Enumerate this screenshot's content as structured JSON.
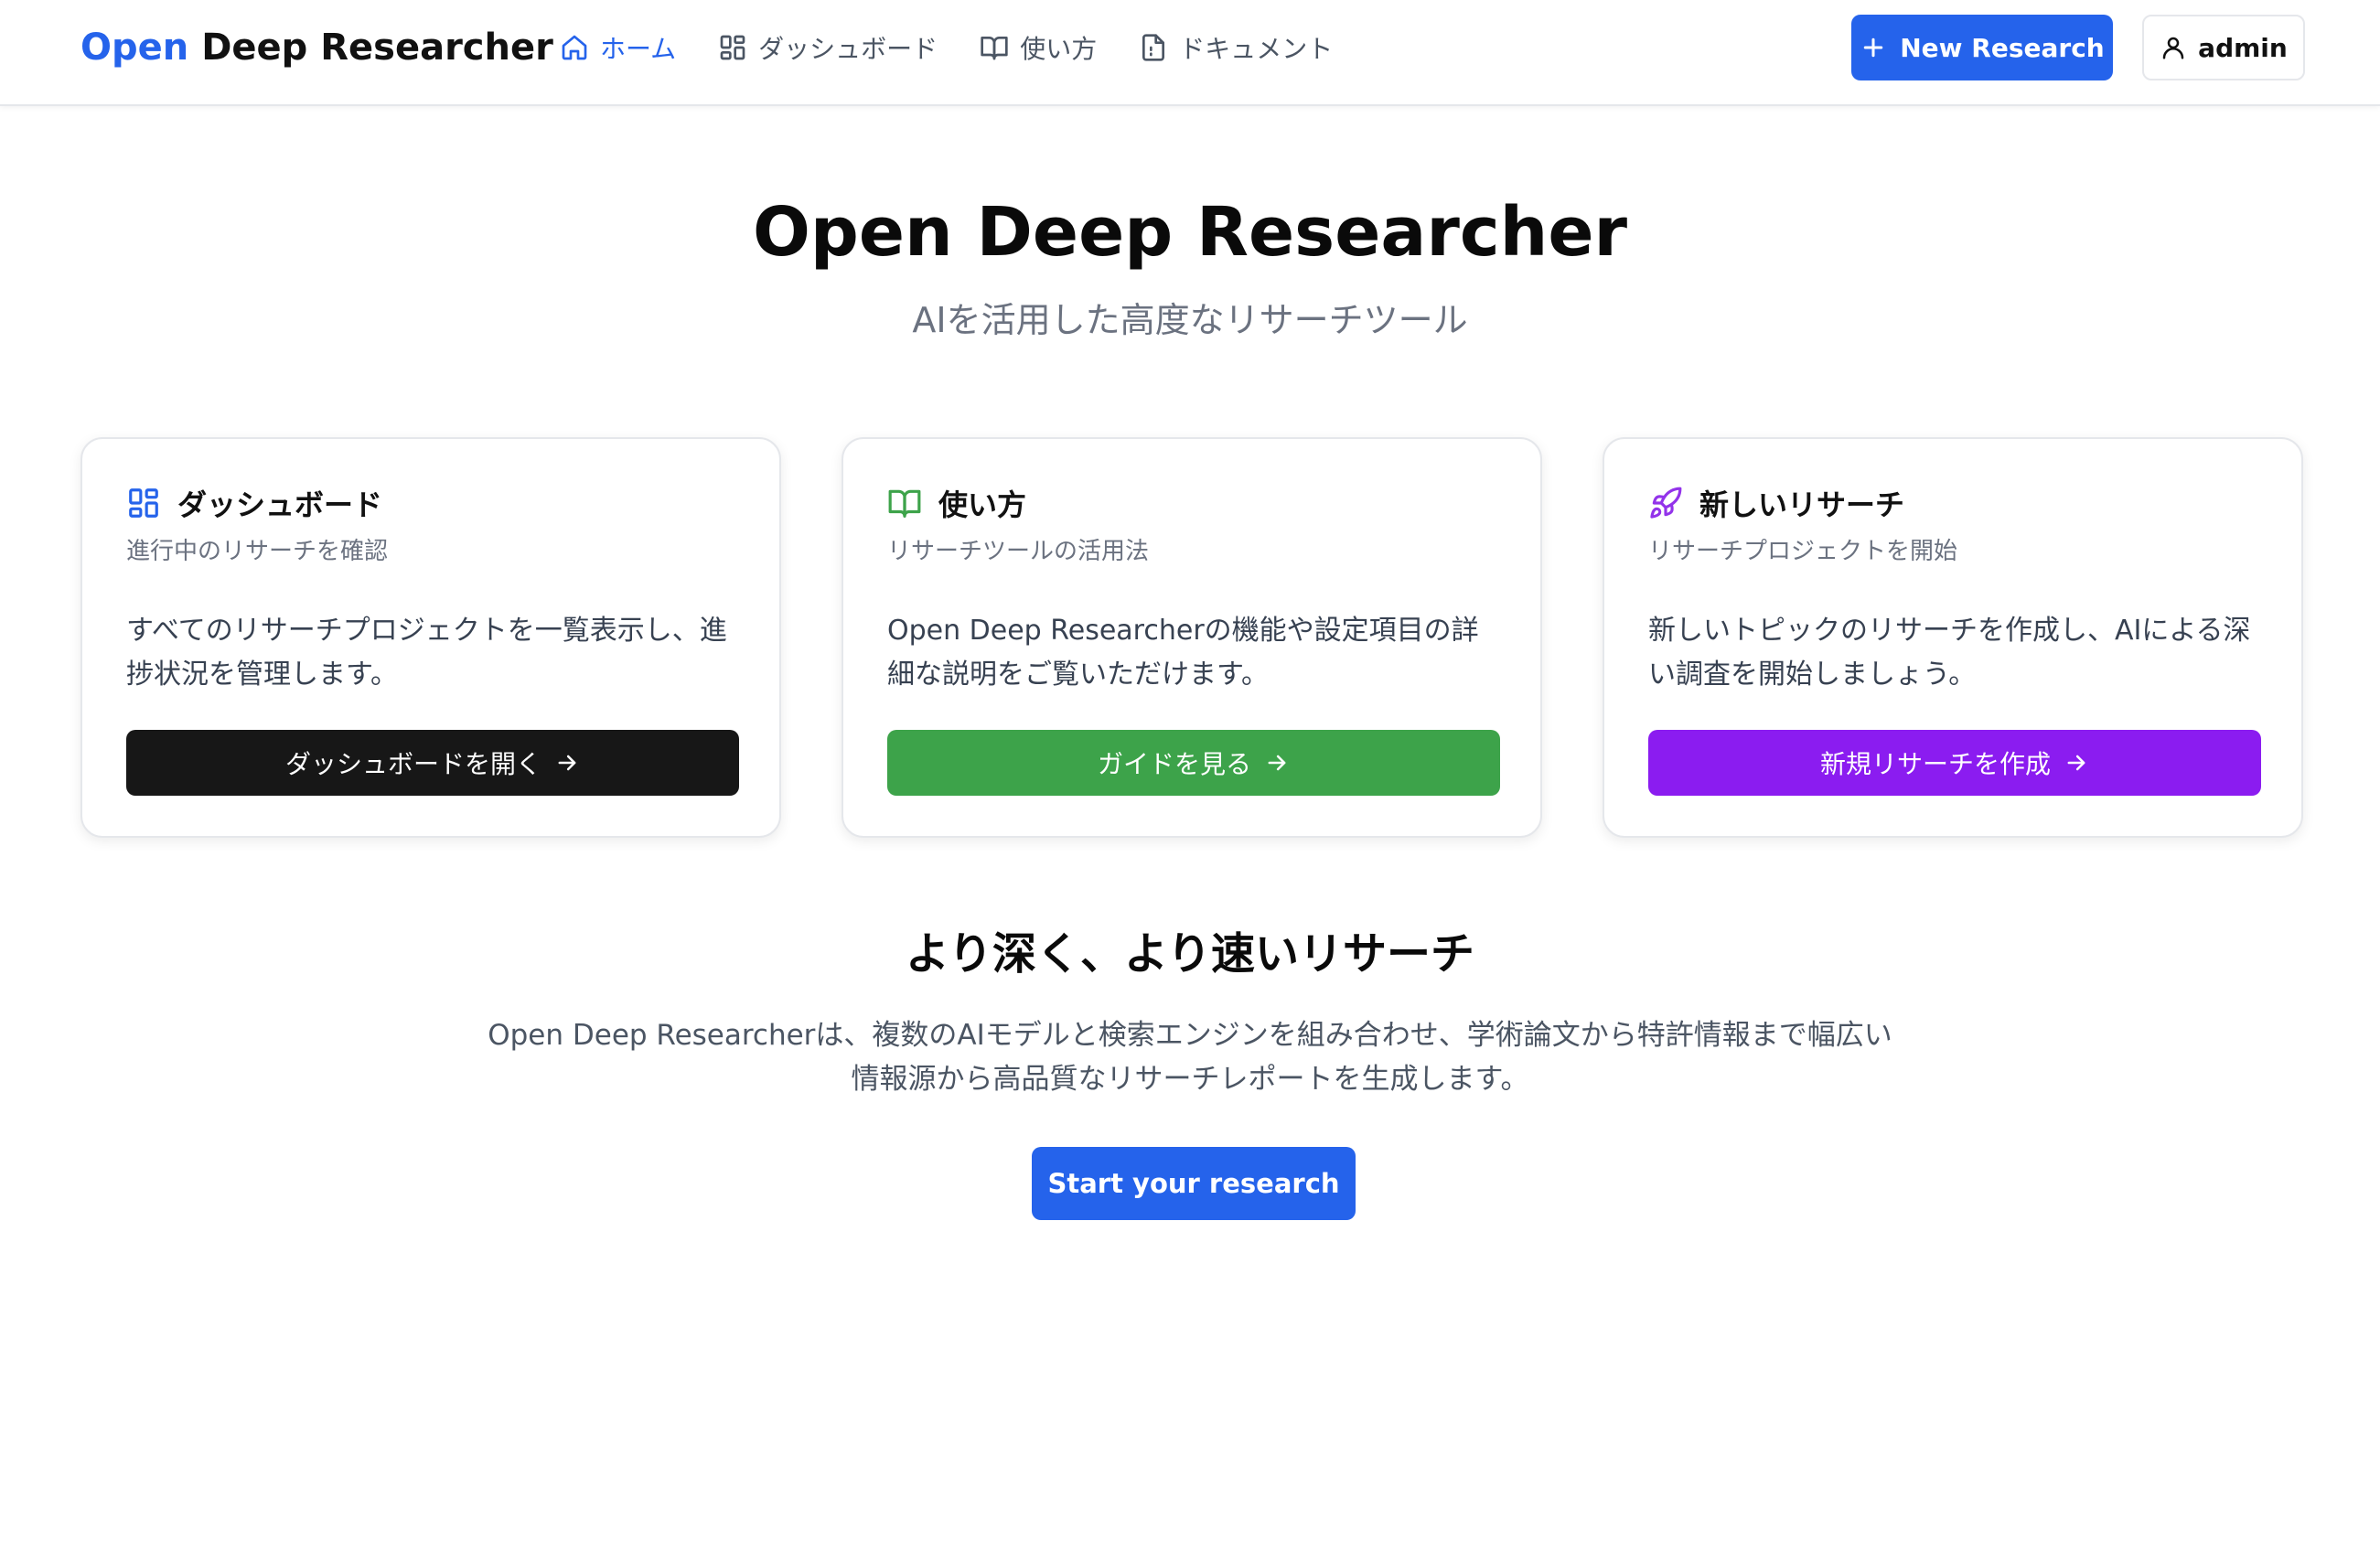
{
  "header": {
    "logo_accent": "Open",
    "logo_rest": "Deep Researcher",
    "nav": [
      {
        "label": "ホーム",
        "icon": "home-icon",
        "active": true
      },
      {
        "label": "ダッシュボード",
        "icon": "dashboard-icon",
        "active": false
      },
      {
        "label": "使い方",
        "icon": "book-icon",
        "active": false
      },
      {
        "label": "ドキュメント",
        "icon": "document-icon",
        "active": false
      }
    ],
    "new_research_label": "New Research",
    "user_label": "admin"
  },
  "hero": {
    "title": "Open Deep Researcher",
    "subtitle": "AIを活用した高度なリサーチツール"
  },
  "cards": [
    {
      "title": "ダッシュボード",
      "description": "進行中のリサーチを確認",
      "body": "すべてのリサーチプロジェクトを一覧表示し、進捗状況を管理します。",
      "button": "ダッシュボードを開く",
      "icon": "dashboard-icon",
      "color": "#171717",
      "icon_color": "#2563eb"
    },
    {
      "title": "使い方",
      "description": "リサーチツールの活用法",
      "body": "Open Deep Researcherの機能や設定項目の詳細な説明をご覧いただけます。",
      "button": "ガイドを見る",
      "icon": "book-open-icon",
      "color": "#3da34a",
      "icon_color": "#3da34a"
    },
    {
      "title": "新しいリサーチ",
      "description": "リサーチプロジェクトを開始",
      "body": "新しいトピックのリサーチを作成し、AIによる深い調査を開始しましょう。",
      "button": "新規リサーチを作成",
      "icon": "rocket-icon",
      "color": "#8b1cf0",
      "icon_color": "#9333ea"
    }
  ],
  "section": {
    "title": "より深く、より速いリサーチ",
    "body": "Open Deep Researcherは、複数のAIモデルと検索エンジンを組み合わせ、学術論文から特許情報まで幅広い情報源から高品質なリサーチレポートを生成します。",
    "cta": "Start your research"
  },
  "colors": {
    "primary": "#2563eb",
    "text_muted": "#6b7280"
  }
}
